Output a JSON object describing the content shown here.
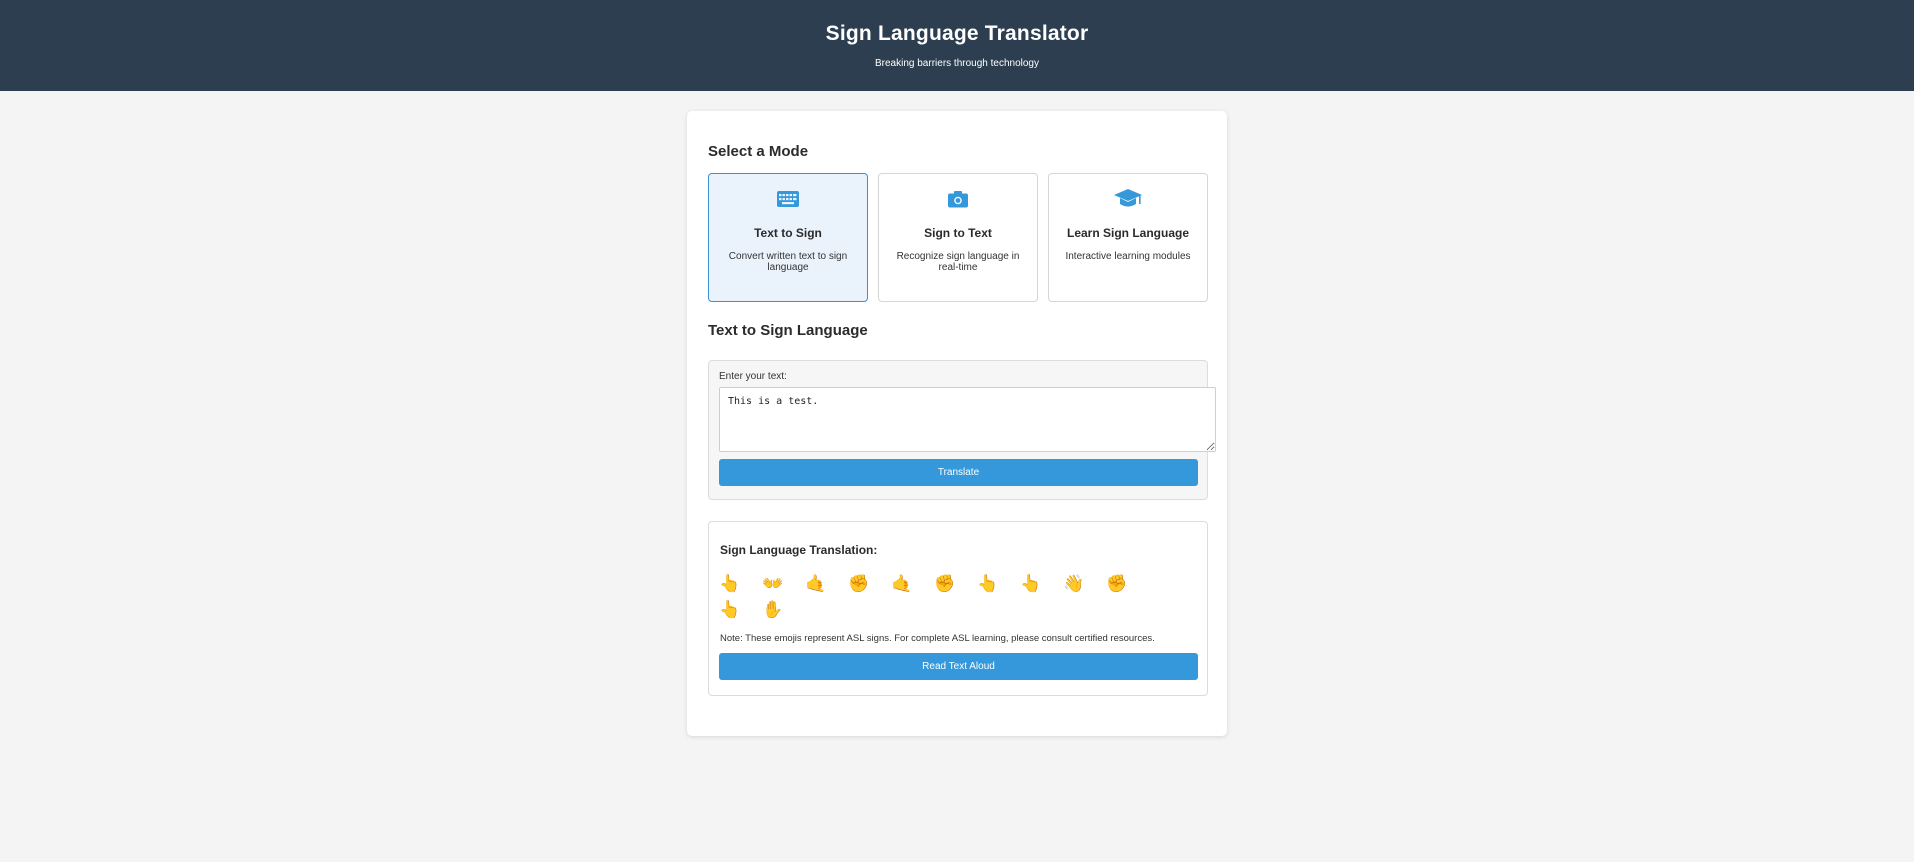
{
  "header": {
    "title": "Sign Language Translator",
    "subtitle": "Breaking barriers through technology"
  },
  "modes_section": {
    "title": "Select a Mode",
    "modes": [
      {
        "icon": "keyboard-icon",
        "title": "Text to Sign",
        "description": "Convert written text to sign language",
        "active": true
      },
      {
        "icon": "camera-icon",
        "title": "Sign to Text",
        "description": "Recognize sign language in real-time",
        "active": false
      },
      {
        "icon": "graduation-cap-icon",
        "title": "Learn Sign Language",
        "description": "Interactive learning modules",
        "active": false
      }
    ]
  },
  "translator": {
    "title": "Text to Sign Language",
    "input_label": "Enter your text:",
    "input_value": "This is a test.",
    "translate_label": "Translate"
  },
  "output": {
    "title": "Sign Language Translation:",
    "signs": [
      "👆",
      "👐",
      "🤙",
      "✊",
      "🤙",
      "✊",
      "👆",
      "👆",
      "👋",
      "✊",
      "👆",
      "✋"
    ],
    "note": "Note: These emojis represent ASL signs. For complete ASL learning, please consult certified resources.",
    "read_aloud_label": "Read Text Aloud"
  },
  "colors": {
    "header_bg": "#2c3e50",
    "accent": "#3498db",
    "active_mode_bg": "#eaf3fc"
  }
}
